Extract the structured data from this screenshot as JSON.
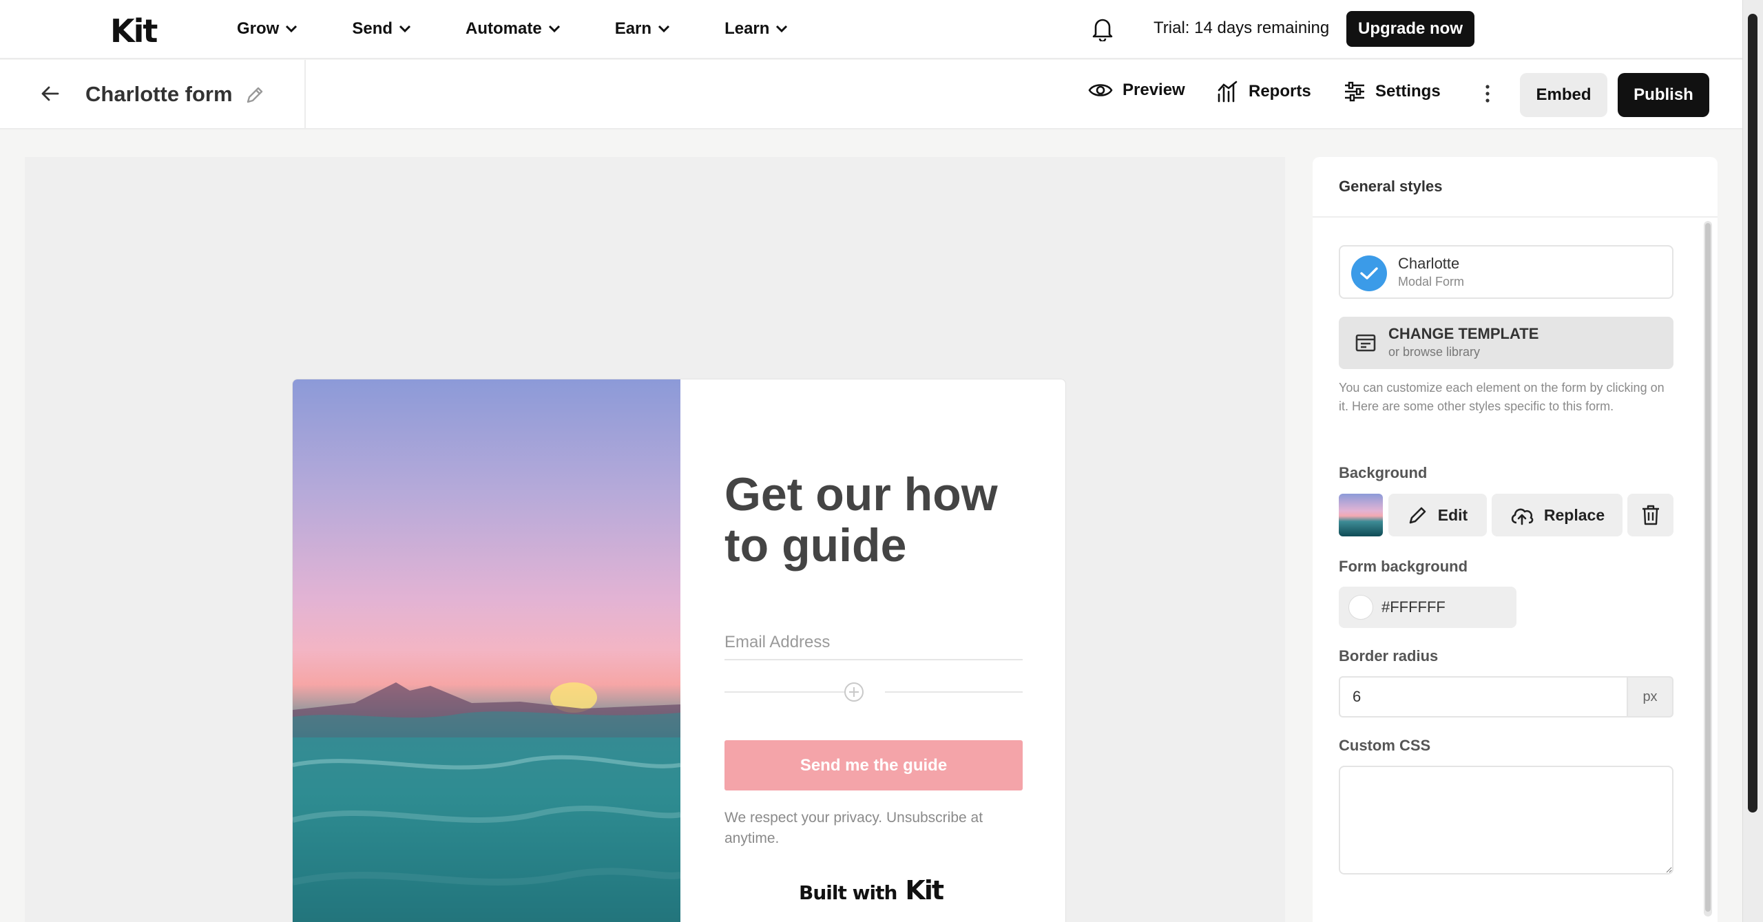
{
  "nav": {
    "logo": "Kit",
    "items": [
      {
        "label": "Grow"
      },
      {
        "label": "Send"
      },
      {
        "label": "Automate"
      },
      {
        "label": "Earn"
      },
      {
        "label": "Learn"
      }
    ],
    "trial": "Trial: 14 days remaining",
    "upgrade": "Upgrade now"
  },
  "header": {
    "title": "Charlotte form",
    "preview": "Preview",
    "reports": "Reports",
    "settings": "Settings",
    "embed": "Embed",
    "publish": "Publish"
  },
  "form": {
    "heading": "Get our how to guide",
    "email_placeholder": "Email Address",
    "button": "Send me the guide",
    "button_color": "#F4A4A9",
    "privacy": "We respect your privacy. Unsubscribe at anytime.",
    "built_with": "Built with",
    "built_logo": "Kit"
  },
  "panel": {
    "title": "General styles",
    "template_name": "Charlotte",
    "template_type": "Modal Form",
    "change_template": "CHANGE TEMPLATE",
    "change_sub": "or browse library",
    "help": "You can customize each element on the form by clicking on it. Here are some other styles specific to this form.",
    "background_label": "Background",
    "edit": "Edit",
    "replace": "Replace",
    "form_background_label": "Form background",
    "form_background_value": "#FFFFFF",
    "border_radius_label": "Border radius",
    "border_radius_value": "6",
    "border_radius_unit": "px",
    "custom_css_label": "Custom CSS",
    "custom_css_value": ""
  }
}
